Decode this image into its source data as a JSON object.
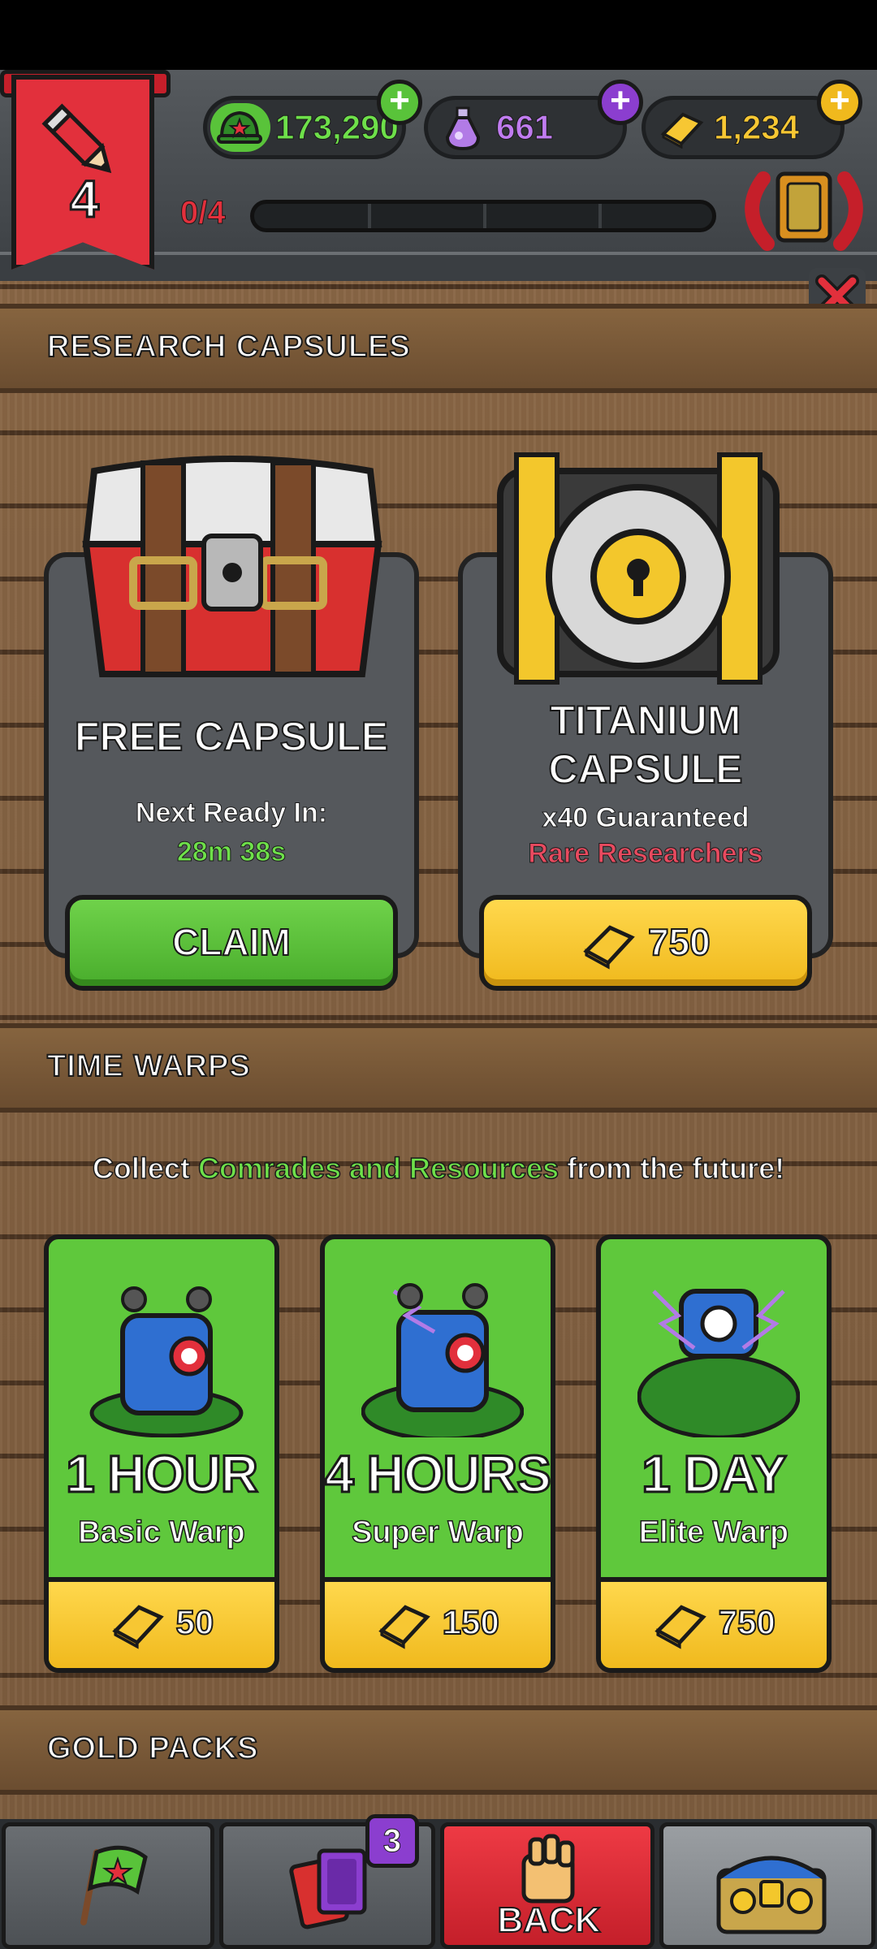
{
  "hud": {
    "level": "4",
    "currencies": {
      "helmets": "173,290",
      "potions": "661",
      "gold": "1,234"
    },
    "progress": {
      "label": "0/4",
      "fraction": 0
    }
  },
  "sections": {
    "research_capsules": "RESEARCH CAPSULES",
    "time_warps": "TIME WARPS",
    "gold_packs": "GOLD PACKS"
  },
  "capsules": {
    "free": {
      "title": "FREE CAPSULE",
      "next_label": "Next Ready In:",
      "timer": "28m 38s",
      "button": "CLAIM"
    },
    "titanium": {
      "title_line1": "TITANIUM",
      "title_line2": "CAPSULE",
      "guaranteed": "x40 Guaranteed",
      "rarity": "Rare Researchers",
      "price": "750"
    }
  },
  "collect": {
    "prefix": "Collect",
    "highlight": "Comrades and Resources",
    "suffix": "from the future!"
  },
  "warps": [
    {
      "duration": "1 HOUR",
      "name": "Basic Warp",
      "price": "50"
    },
    {
      "duration": "4 HOURS",
      "name": "Super Warp",
      "price": "150"
    },
    {
      "duration": "1 DAY",
      "name": "Elite Warp",
      "price": "750"
    }
  ],
  "nav": {
    "badge_count": "3",
    "back_label": "BACK"
  },
  "colors": {
    "accent_green": "#59c33a",
    "accent_red": "#e2303c",
    "gold": "#f0b91d",
    "purple": "#8b3ecf",
    "rare_text": "#e84a5f"
  }
}
